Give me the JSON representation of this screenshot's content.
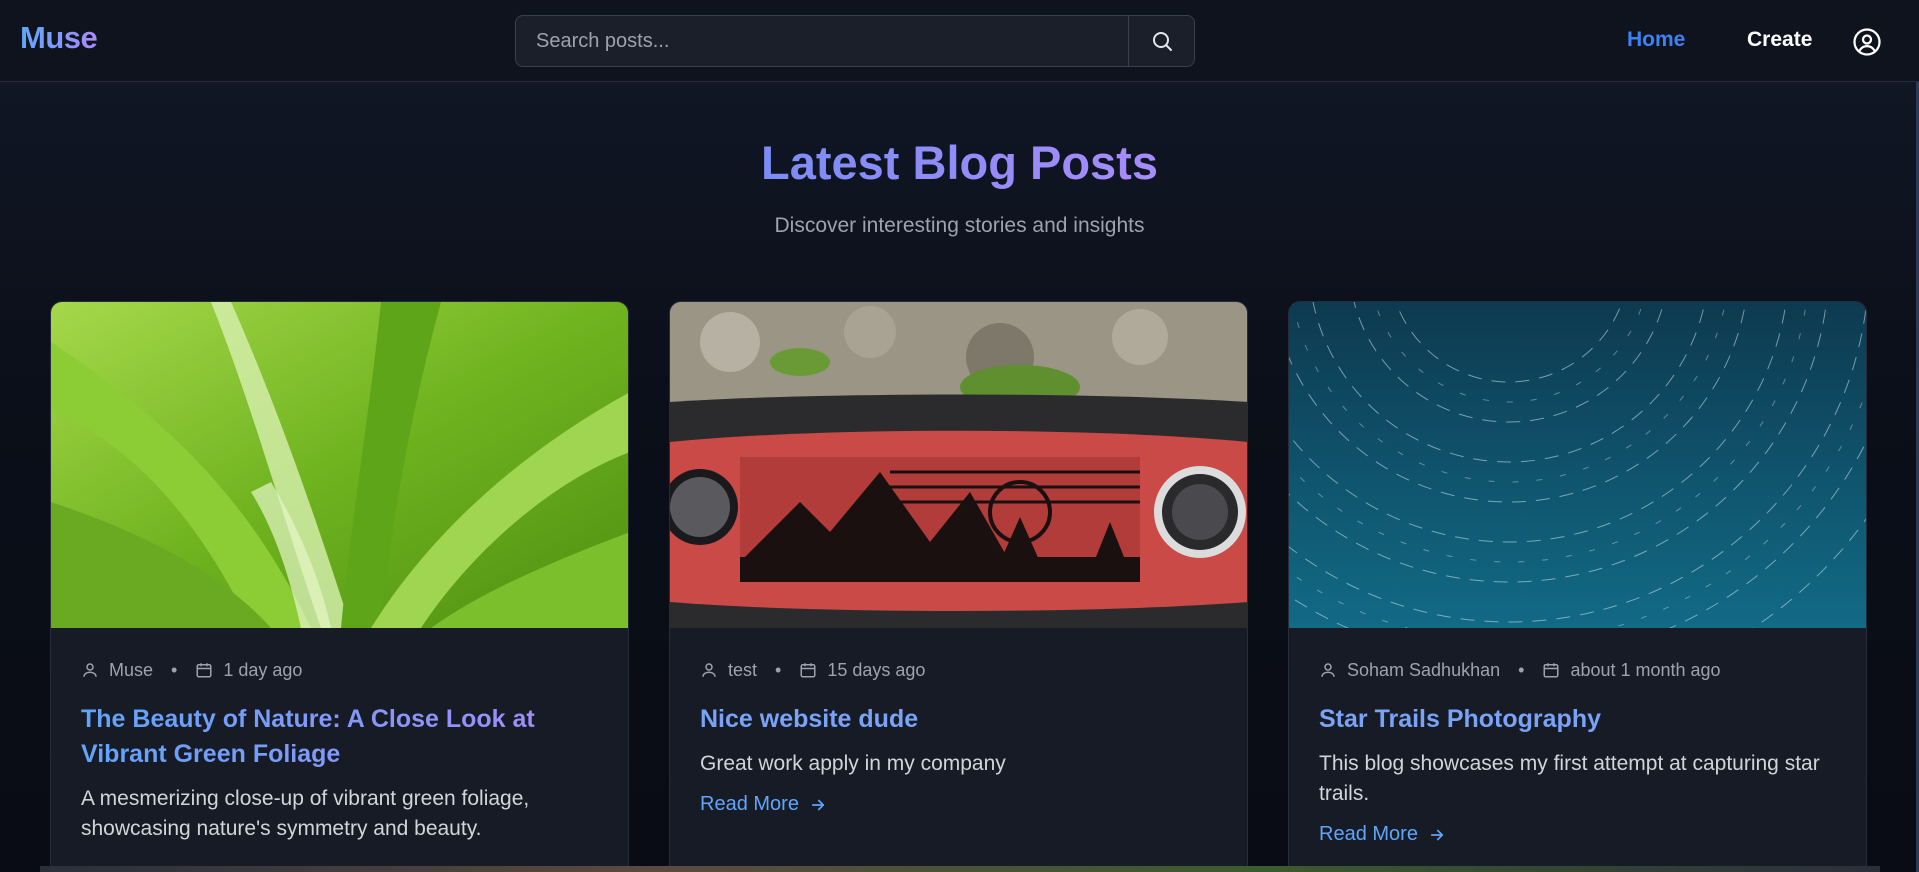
{
  "header": {
    "logo": "Muse",
    "search_placeholder": "Search posts...",
    "nav_home": "Home",
    "nav_create": "Create",
    "accent_color": "#3b82f6"
  },
  "hero": {
    "title": "Latest Blog Posts",
    "subtitle": "Discover interesting stories and insights"
  },
  "posts": [
    {
      "author": "Muse",
      "date": "1 day ago",
      "title": "The Beauty of Nature: A Close Look at Vibrant Green Foliage",
      "excerpt": "A mesmerizing close-up of vibrant green foliage, showcasing nature's symmetry and beauty.",
      "image": "green-foliage-image"
    },
    {
      "author": "test",
      "date": "15 days ago",
      "title": "Nice website dude",
      "excerpt": "Great work apply in my company",
      "read_more": "Read More",
      "image": "jeep-dashboard-image"
    },
    {
      "author": "Soham Sadhukhan",
      "date": "about 1 month ago",
      "title": "Star Trails Photography",
      "excerpt": "This blog showcases my first attempt at capturing star trails.",
      "read_more": "Read More",
      "image": "star-trails-image"
    }
  ]
}
